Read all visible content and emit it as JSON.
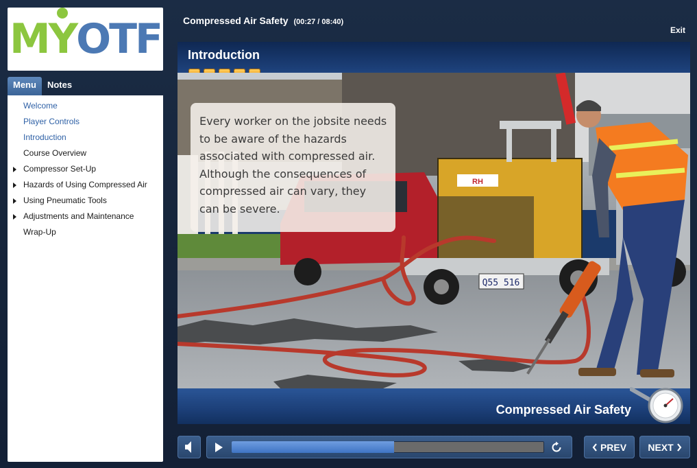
{
  "logo": {
    "text_m": "M",
    "text_y": "Y",
    "text_otf": "OTF"
  },
  "tabs": [
    {
      "label": "Menu",
      "active": true
    },
    {
      "label": "Notes",
      "active": false
    }
  ],
  "menu": [
    {
      "label": "Welcome",
      "visited": true,
      "expandable": false
    },
    {
      "label": "Player Controls",
      "visited": true,
      "expandable": false
    },
    {
      "label": "Introduction",
      "visited": true,
      "expandable": false
    },
    {
      "label": "Course Overview",
      "visited": false,
      "expandable": false
    },
    {
      "label": "Compressor Set-Up",
      "visited": false,
      "expandable": true
    },
    {
      "label": "Hazards of Using Compressed Air",
      "visited": false,
      "expandable": true
    },
    {
      "label": "Using Pneumatic Tools",
      "visited": false,
      "expandable": true
    },
    {
      "label": "Adjustments and Maintenance",
      "visited": false,
      "expandable": true
    },
    {
      "label": "Wrap-Up",
      "visited": false,
      "expandable": false
    }
  ],
  "header": {
    "course_title": "Compressed Air Safety",
    "time": "(00:27 / 08:40)",
    "exit_label": "Exit"
  },
  "slide": {
    "title": "Introduction",
    "progress_squares": 5,
    "caption": "Every worker on the jobsite needs to be aware of the hazards associated with compressed air. Although the consequences of compressed air can vary, they can be severe.",
    "footer_title": "Compressed Air Safety"
  },
  "player": {
    "progress_fraction": 0.52,
    "prev_label": "PREV",
    "next_label": "NEXT"
  },
  "colors": {
    "logo_green": "#8cc63f",
    "logo_blue": "#4c79b4",
    "visited_link": "#2f61a6",
    "progress_fill": "#3f74c4",
    "square_gold": "#f5a623"
  }
}
